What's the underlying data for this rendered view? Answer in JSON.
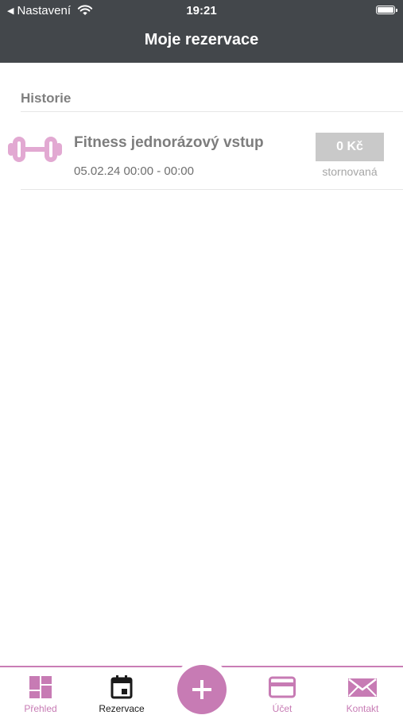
{
  "statusbar": {
    "back_label": "Nastavení",
    "time": "19:21"
  },
  "header": {
    "title": "Moje rezervace"
  },
  "history": {
    "section_label": "Historie",
    "items": [
      {
        "name": "Fitness jednorázový vstup",
        "datetime": "05.02.24 00:00 - 00:00",
        "price": "0 Kč",
        "status": "stornovaná",
        "icon": "dumbbell-icon"
      }
    ]
  },
  "tabbar": {
    "tabs": [
      {
        "label": "Přehled",
        "icon": "dashboard-icon",
        "active": false
      },
      {
        "label": "Rezervace",
        "icon": "calendar-icon",
        "active": true
      },
      {
        "label": "",
        "icon": "plus-icon",
        "active": false
      },
      {
        "label": "Účet",
        "icon": "card-icon",
        "active": false
      },
      {
        "label": "Kontakt",
        "icon": "envelope-icon",
        "active": false
      }
    ]
  },
  "colors": {
    "header_bg": "#43474b",
    "accent": "#c77bb4",
    "price_badge": "#c9c9c9"
  }
}
